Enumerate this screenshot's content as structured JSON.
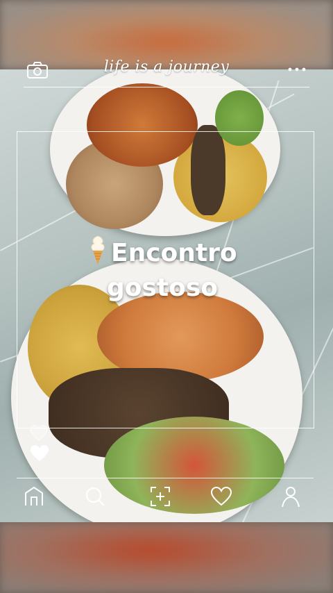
{
  "header": {
    "title": "life is a journey",
    "camera_icon": "camera-icon",
    "more_icon": "more-dots-icon"
  },
  "post": {
    "emoji": "soft-ice-cream-icon",
    "headline_line1": "Encontro",
    "headline_line2": "gostoso"
  },
  "reactions": {
    "small_heart_icon": "heart-outline-icon",
    "main_heart_icon": "heart-filled-icon"
  },
  "navbar": {
    "items": [
      {
        "name": "home",
        "icon": "home-icon"
      },
      {
        "name": "search",
        "icon": "search-icon"
      },
      {
        "name": "add",
        "icon": "add-post-icon"
      },
      {
        "name": "likes",
        "icon": "heart-icon"
      },
      {
        "name": "profile",
        "icon": "profile-icon"
      }
    ]
  },
  "colors": {
    "overlay": "#ffffff",
    "icecream_cone": "#e8a24a"
  }
}
